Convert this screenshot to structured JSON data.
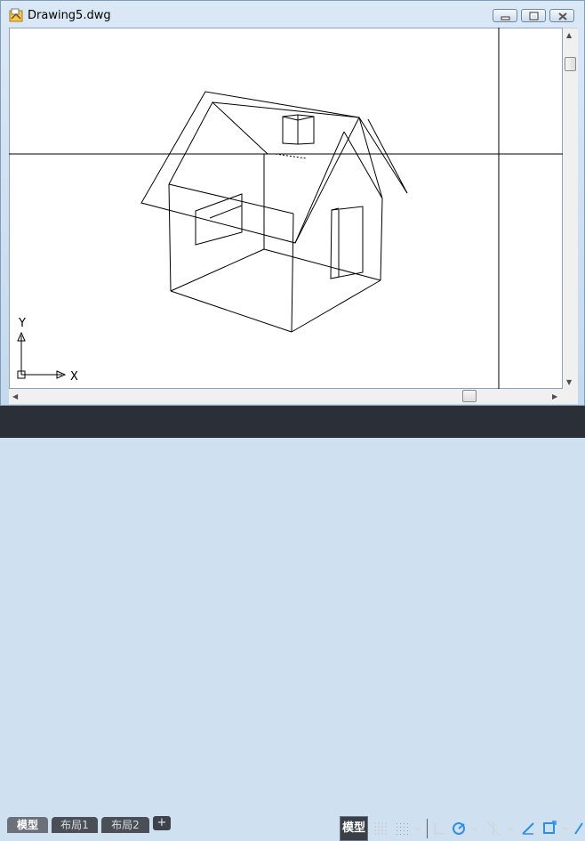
{
  "window": {
    "title": "Drawing5.dwg"
  },
  "ucs": {
    "y_label": "Y",
    "x_label": "X"
  },
  "layout_tabs": [
    {
      "label": "模型",
      "active": true
    },
    {
      "label": "布局1",
      "active": false
    },
    {
      "label": "布局2",
      "active": false
    }
  ],
  "add_tab_label": "+",
  "status": {
    "model_label": "模型"
  },
  "colors": {
    "background": "#ffffff",
    "linework": "#000000",
    "statusbar": "#2b2f36",
    "tool_accent": "#2f8fe6"
  }
}
